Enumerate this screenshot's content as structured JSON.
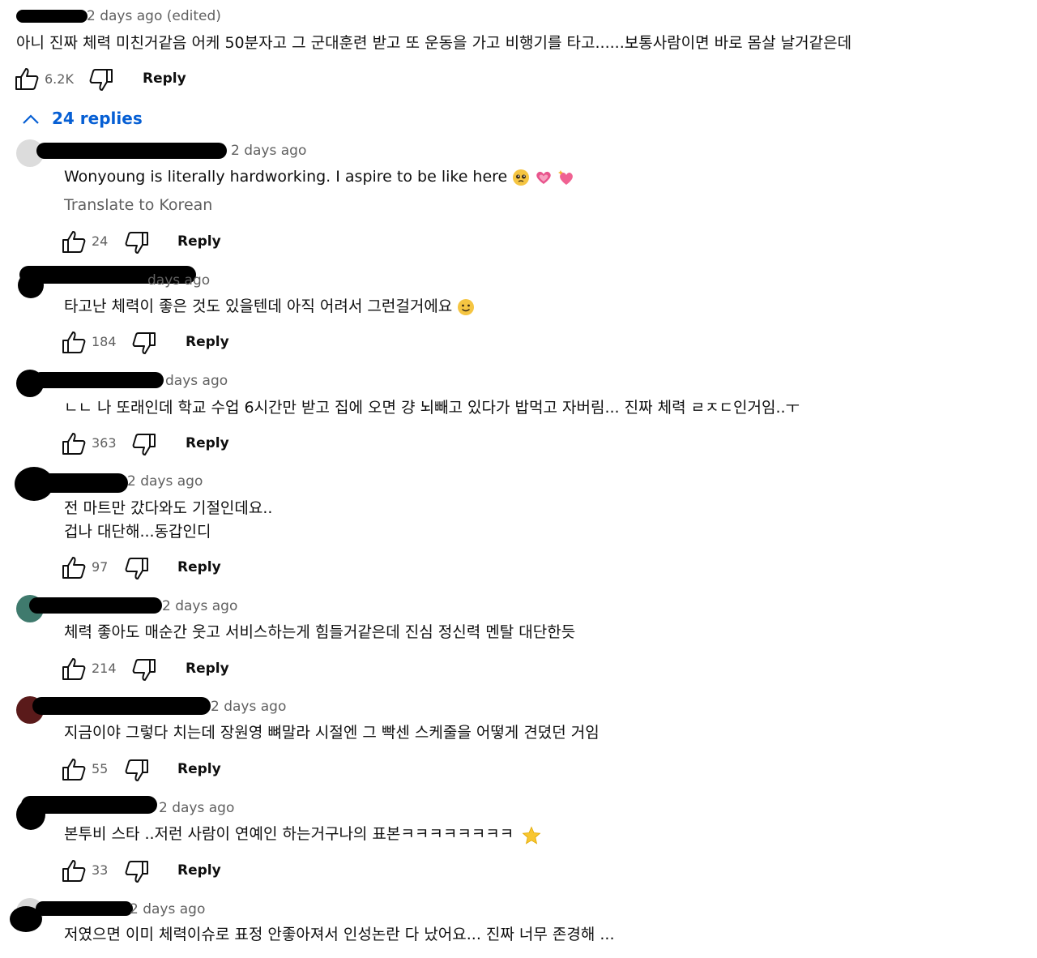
{
  "top_comment": {
    "time": "2 days ago (edited)",
    "text": "아니 진짜 체력 미친거같음 어케 50분자고 그 군대훈련 받고 또 운동을 가고 비행기를 타고......보통사람이면 바로 몸살 날거같은데",
    "likes": "6.2K",
    "reply_label": "Reply"
  },
  "replies_toggle": {
    "label": "24 replies",
    "icon": "chevron-up-icon"
  },
  "replies": [
    {
      "time": "2 days ago",
      "text": "Wonyoung is literally hardworking. I aspire to be like here",
      "emojis": [
        "pleading-face",
        "heart",
        "sparkling-heart"
      ],
      "translate": "Translate to Korean",
      "likes": "24",
      "reply_label": "Reply"
    },
    {
      "time": "days ago",
      "text": "타고난 체력이 좋은 것도 있을텐데 아직 어려서 그런걸거에요",
      "emojis": [
        "smiling-face"
      ],
      "likes": "184",
      "reply_label": "Reply"
    },
    {
      "time": "days ago",
      "text": "ㄴㄴ 나 또래인데 학교 수업 6시간만 받고 집에 오면 걍 뇌빼고 있다가 밥먹고 자버림... 진짜 체력 ㄹㅈㄷ인거임..ㅜ",
      "likes": "363",
      "reply_label": "Reply"
    },
    {
      "time": "2 days ago",
      "text": "전 마트만 갔다와도 기절인데요..",
      "text2": "겁나 대단해...동갑인디",
      "likes": "97",
      "reply_label": "Reply"
    },
    {
      "time": "2 days ago",
      "text": "체력 좋아도 매순간 웃고 서비스하는게 힘들거같은데 진심 정신력 멘탈 대단한듯",
      "likes": "214",
      "reply_label": "Reply"
    },
    {
      "time": "2 days ago",
      "text": "지금이야 그렇다 치는데 장원영 뼈말라 시절엔 그 빡센 스케줄을 어떻게 견뎠던 거임",
      "likes": "55",
      "reply_label": "Reply"
    },
    {
      "time": "2 days ago",
      "text": "본투비 스타 ..저런 사람이 연예인 하는거구나의 표본ㅋㅋㅋㅋㅋㅋㅋㅋ",
      "emojis": [
        "star"
      ],
      "likes": "33",
      "reply_label": "Reply"
    },
    {
      "time": "2 days ago",
      "text": "저였으면 이미 체력이슈로 표정 안좋아져서 인성논란 다 났어요... 진짜 너무 존경해 ..."
    }
  ],
  "colors": {
    "link": "#065fd4",
    "meta": "#606060",
    "text": "#0f0f0f"
  }
}
